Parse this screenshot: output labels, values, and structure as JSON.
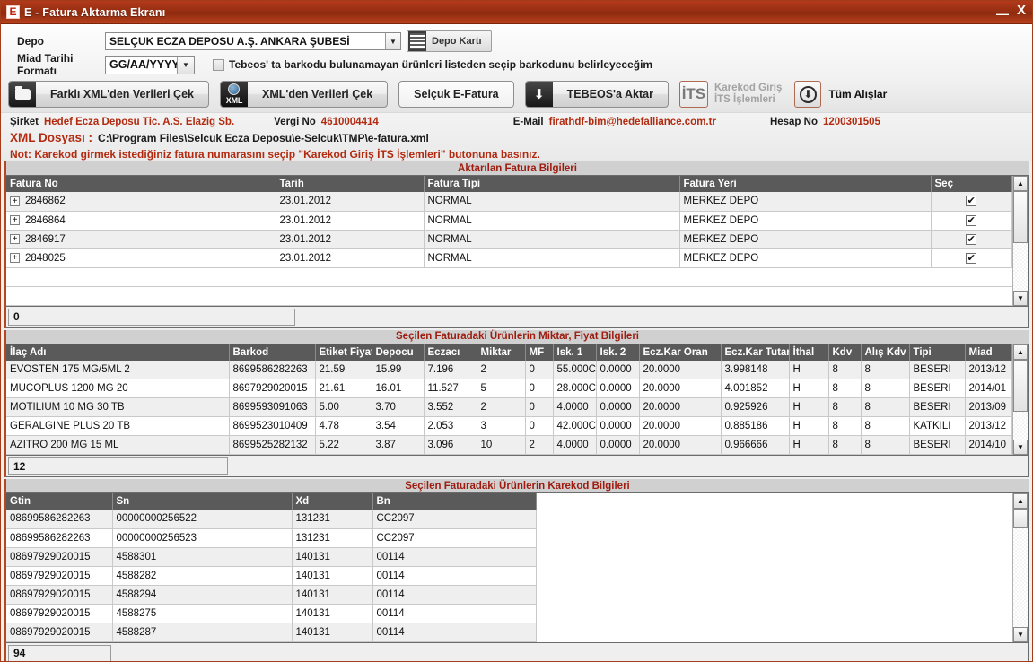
{
  "window": {
    "title": "E - Fatura Aktarma Ekranı",
    "icon": "E",
    "minimize_label": "—",
    "close_label": "X",
    "accent_color": "#b22b10",
    "titlebar_color": "#992f12"
  },
  "form": {
    "depo_label": "Depo",
    "depo_value": "SELÇUK ECZA DEPOSU A.Ş. ANKARA ŞUBESİ",
    "depo_kart_button": "Depo Kartı",
    "miad_label": "Miad Tarihi Formatı",
    "miad_value": "GG/AA/YYYY",
    "tebeos_checkbox_label": "Tebeos' ta barkodu bulunamayan ürünleri listeden seçip barkodunu belirleyeceğim",
    "tebeos_checkbox_checked": false
  },
  "actions": {
    "farkli_xml": "Farklı XML'den Verileri Çek",
    "xml_cek": "XML'den Verileri Çek",
    "xml_icon_label": "XML",
    "selcuk_efatura": "Selçuk E-Fatura",
    "tebeos_aktar": "TEBEOS'a Aktar",
    "its_icon_label": "İTS",
    "its_line1": "Karekod Giriş",
    "its_line2": "İTS İşlemleri",
    "tum_alislar": "Tüm Alışlar"
  },
  "info": {
    "sirket_label": "Şirket",
    "sirket_value": "Hedef Ecza Deposu Tic. A.S. Elazig Sb.",
    "vergi_label": "Vergi No",
    "vergi_value": "4610004414",
    "email_label": "E-Mail",
    "email_value": "firathdf-bim@hedefalliance.com.tr",
    "hesap_label": "Hesap No",
    "hesap_value": "1200301505",
    "xml_label": "XML Dosyası :",
    "xml_value": "C:\\Program Files\\Selcuk Ecza Deposu\\e-Selcuk\\TMP\\e-fatura.xml",
    "note": "Not: Karekod girmek istediğiniz fatura numarasını seçip \"Karekod Giriş İTS İşlemleri\" butonuna basınız."
  },
  "invoices_section": {
    "title": "Aktarılan Fatura Bilgileri",
    "columns": [
      "Fatura No",
      "Tarih",
      "Fatura Tipi",
      "Fatura Yeri",
      "Seç"
    ],
    "rows": [
      {
        "no": "2846862",
        "tarih": "23.01.2012",
        "tipi": "NORMAL",
        "yeri": "MERKEZ DEPO",
        "sec": "✔"
      },
      {
        "no": "2846864",
        "tarih": "23.01.2012",
        "tipi": "NORMAL",
        "yeri": "MERKEZ DEPO",
        "sec": "✔"
      },
      {
        "no": "2846917",
        "tarih": "23.01.2012",
        "tipi": "NORMAL",
        "yeri": "MERKEZ DEPO",
        "sec": "✔"
      },
      {
        "no": "2848025",
        "tarih": "23.01.2012",
        "tipi": "NORMAL",
        "yeri": "MERKEZ DEPO",
        "sec": "✔"
      }
    ],
    "expand_glyph": "+",
    "total_value": "0"
  },
  "products_section": {
    "title": "Seçilen Faturadaki Ürünlerin Miktar, Fiyat Bilgileri",
    "columns": [
      "İlaç Adı",
      "Barkod",
      "Etiket Fiyatı",
      "Depocu",
      "Eczacı",
      "Miktar",
      "MF",
      "Isk. 1",
      "Isk. 2",
      "Ecz.Kar Oran",
      "Ecz.Kar Tutar",
      "İthal",
      "Kdv",
      "Alış Kdv",
      "Tipi",
      "Miad"
    ],
    "rows": [
      {
        "ad": "EVOSTEN 175 MG/5ML 2",
        "barkod": "8699586282263",
        "etiket": "21.59",
        "depocu": "15.99",
        "eczaci": "7.196",
        "miktar": "2",
        "mf": "0",
        "isk1": "55.000C",
        "isk2": "0.0000",
        "karoran": "20.0000",
        "kartutar": "3.998148",
        "ithal": "H",
        "kdv": "8",
        "aliskdv": "8",
        "tipi": "BESERI",
        "miad": "2013/12"
      },
      {
        "ad": "MUCOPLUS 1200 MG 20",
        "barkod": "8697929020015",
        "etiket": "21.61",
        "depocu": "16.01",
        "eczaci": "11.527",
        "miktar": "5",
        "mf": "0",
        "isk1": "28.000C",
        "isk2": "0.0000",
        "karoran": "20.0000",
        "kartutar": "4.001852",
        "ithal": "H",
        "kdv": "8",
        "aliskdv": "8",
        "tipi": "BESERI",
        "miad": "2014/01"
      },
      {
        "ad": "MOTILIUM 10 MG 30 TB",
        "barkod": "8699593091063",
        "etiket": "5.00",
        "depocu": "3.70",
        "eczaci": "3.552",
        "miktar": "2",
        "mf": "0",
        "isk1": "4.0000",
        "isk2": "0.0000",
        "karoran": "20.0000",
        "kartutar": "0.925926",
        "ithal": "H",
        "kdv": "8",
        "aliskdv": "8",
        "tipi": "BESERI",
        "miad": "2013/09"
      },
      {
        "ad": "GERALGINE PLUS 20 TB",
        "barkod": "8699523010409",
        "etiket": "4.78",
        "depocu": "3.54",
        "eczaci": "2.053",
        "miktar": "3",
        "mf": "0",
        "isk1": "42.000C",
        "isk2": "0.0000",
        "karoran": "20.0000",
        "kartutar": "0.885186",
        "ithal": "H",
        "kdv": "8",
        "aliskdv": "8",
        "tipi": "KATKILI",
        "miad": "2013/12"
      },
      {
        "ad": "AZITRO 200 MG 15 ML",
        "barkod": "8699525282132",
        "etiket": "5.22",
        "depocu": "3.87",
        "eczaci": "3.096",
        "miktar": "10",
        "mf": "2",
        "isk1": "4.0000",
        "isk2": "0.0000",
        "karoran": "20.0000",
        "kartutar": "0.966666",
        "ithal": "H",
        "kdv": "8",
        "aliskdv": "8",
        "tipi": "BESERI",
        "miad": "2014/10"
      }
    ],
    "total_value": "12"
  },
  "karekod_section": {
    "title": "Seçilen Faturadaki Ürünlerin Karekod Bilgileri",
    "columns": [
      "Gtin",
      "Sn",
      "Xd",
      "Bn"
    ],
    "rows": [
      {
        "gtin": "08699586282263",
        "sn": "00000000256522",
        "xd": "131231",
        "bn": "CC2097"
      },
      {
        "gtin": "08699586282263",
        "sn": "00000000256523",
        "xd": "131231",
        "bn": "CC2097"
      },
      {
        "gtin": "08697929020015",
        "sn": "4588301",
        "xd": "140131",
        "bn": "00114"
      },
      {
        "gtin": "08697929020015",
        "sn": "4588282",
        "xd": "140131",
        "bn": "00114"
      },
      {
        "gtin": "08697929020015",
        "sn": "4588294",
        "xd": "140131",
        "bn": "00114"
      },
      {
        "gtin": "08697929020015",
        "sn": "4588275",
        "xd": "140131",
        "bn": "00114"
      },
      {
        "gtin": "08697929020015",
        "sn": "4588287",
        "xd": "140131",
        "bn": "00114"
      }
    ],
    "total_value": "94"
  },
  "scroll": {
    "up_glyph": "▲",
    "down_glyph": "▼",
    "combo_glyph": "▼"
  }
}
